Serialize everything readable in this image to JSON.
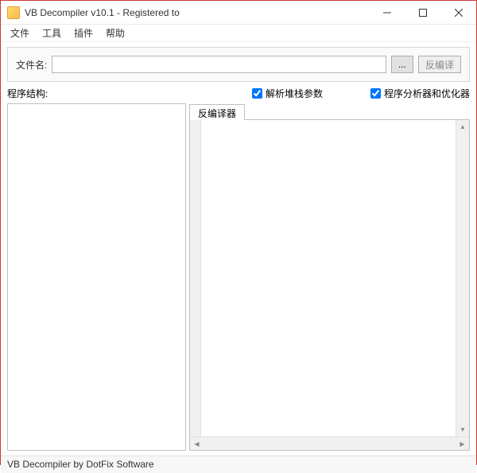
{
  "window": {
    "title": "VB Decompiler v10.1 - Registered to"
  },
  "menu": {
    "file": "文件",
    "tools": "工具",
    "plugins": "插件",
    "help": "帮助"
  },
  "toolbar": {
    "filename_label": "文件名:",
    "filename_value": "",
    "browse_label": "...",
    "decompile_label": "反编译"
  },
  "options": {
    "structure_label": "程序结构:",
    "parse_stack_label": "解析堆栈参数",
    "parse_stack_checked": true,
    "analyzer_label": "程序分析器和优化器",
    "analyzer_checked": true
  },
  "tabs": {
    "decompiler": "反编译器"
  },
  "statusbar": {
    "text": "VB Decompiler by DotFix Software"
  }
}
